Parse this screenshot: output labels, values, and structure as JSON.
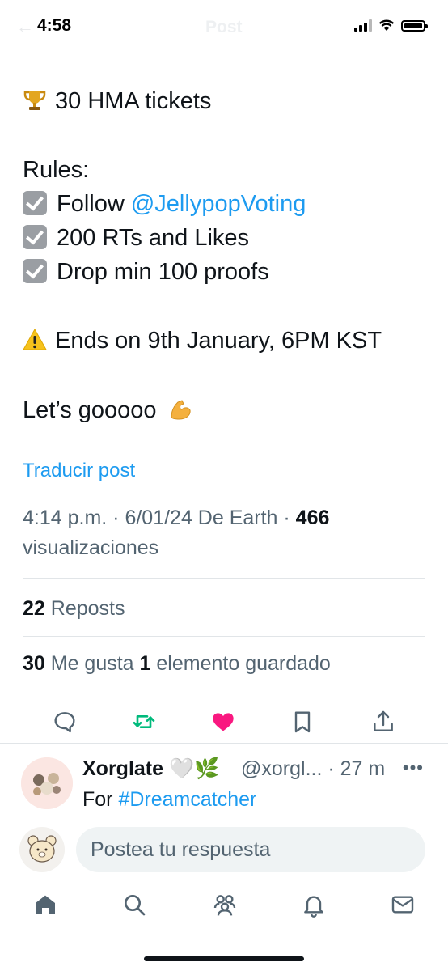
{
  "status_bar": {
    "time": "4:58"
  },
  "header": {
    "title": "Post"
  },
  "tweet": {
    "prize": "30 HMA tickets",
    "rules_heading": "Rules:",
    "rule_1_prefix": "Follow ",
    "rule_1_link": "@JellypopVoting",
    "rule_2": "200 RTs and Likes",
    "rule_3": "Drop min 100 proofs",
    "deadline": "Ends on 9th January, 6PM KST",
    "closing": "Let’s gooooo"
  },
  "translate_label": "Traducir post",
  "meta": {
    "timestamp": "4:14 p.m. · 6/01/24 De Earth · ",
    "views_count": "466",
    "views_label": "visualizaciones"
  },
  "stats": {
    "reposts_count": "22",
    "reposts_label": " Reposts",
    "likes_count": "30",
    "likes_label": " Me gusta ",
    "bookmarks_count": "1",
    "bookmarks_label": " elemento guardado"
  },
  "actions": {
    "reply_icon": "comment-icon",
    "repost_icon": "repost-icon",
    "like_icon": "heart-icon",
    "bookmark_icon": "bookmark-icon",
    "share_icon": "share-icon",
    "repost_color": "#00ba7c",
    "like_color": "#f91880"
  },
  "reply": {
    "name": "Xorglate 🤍🌿",
    "handle": "@xorgl... · 27 m",
    "text_prefix": "For ",
    "text_link": "#Dreamcatcher"
  },
  "compose": {
    "placeholder": "Postea tu respuesta"
  },
  "tabbar": [
    "home-icon",
    "search-icon",
    "communities-icon",
    "bell-icon",
    "mail-icon"
  ]
}
